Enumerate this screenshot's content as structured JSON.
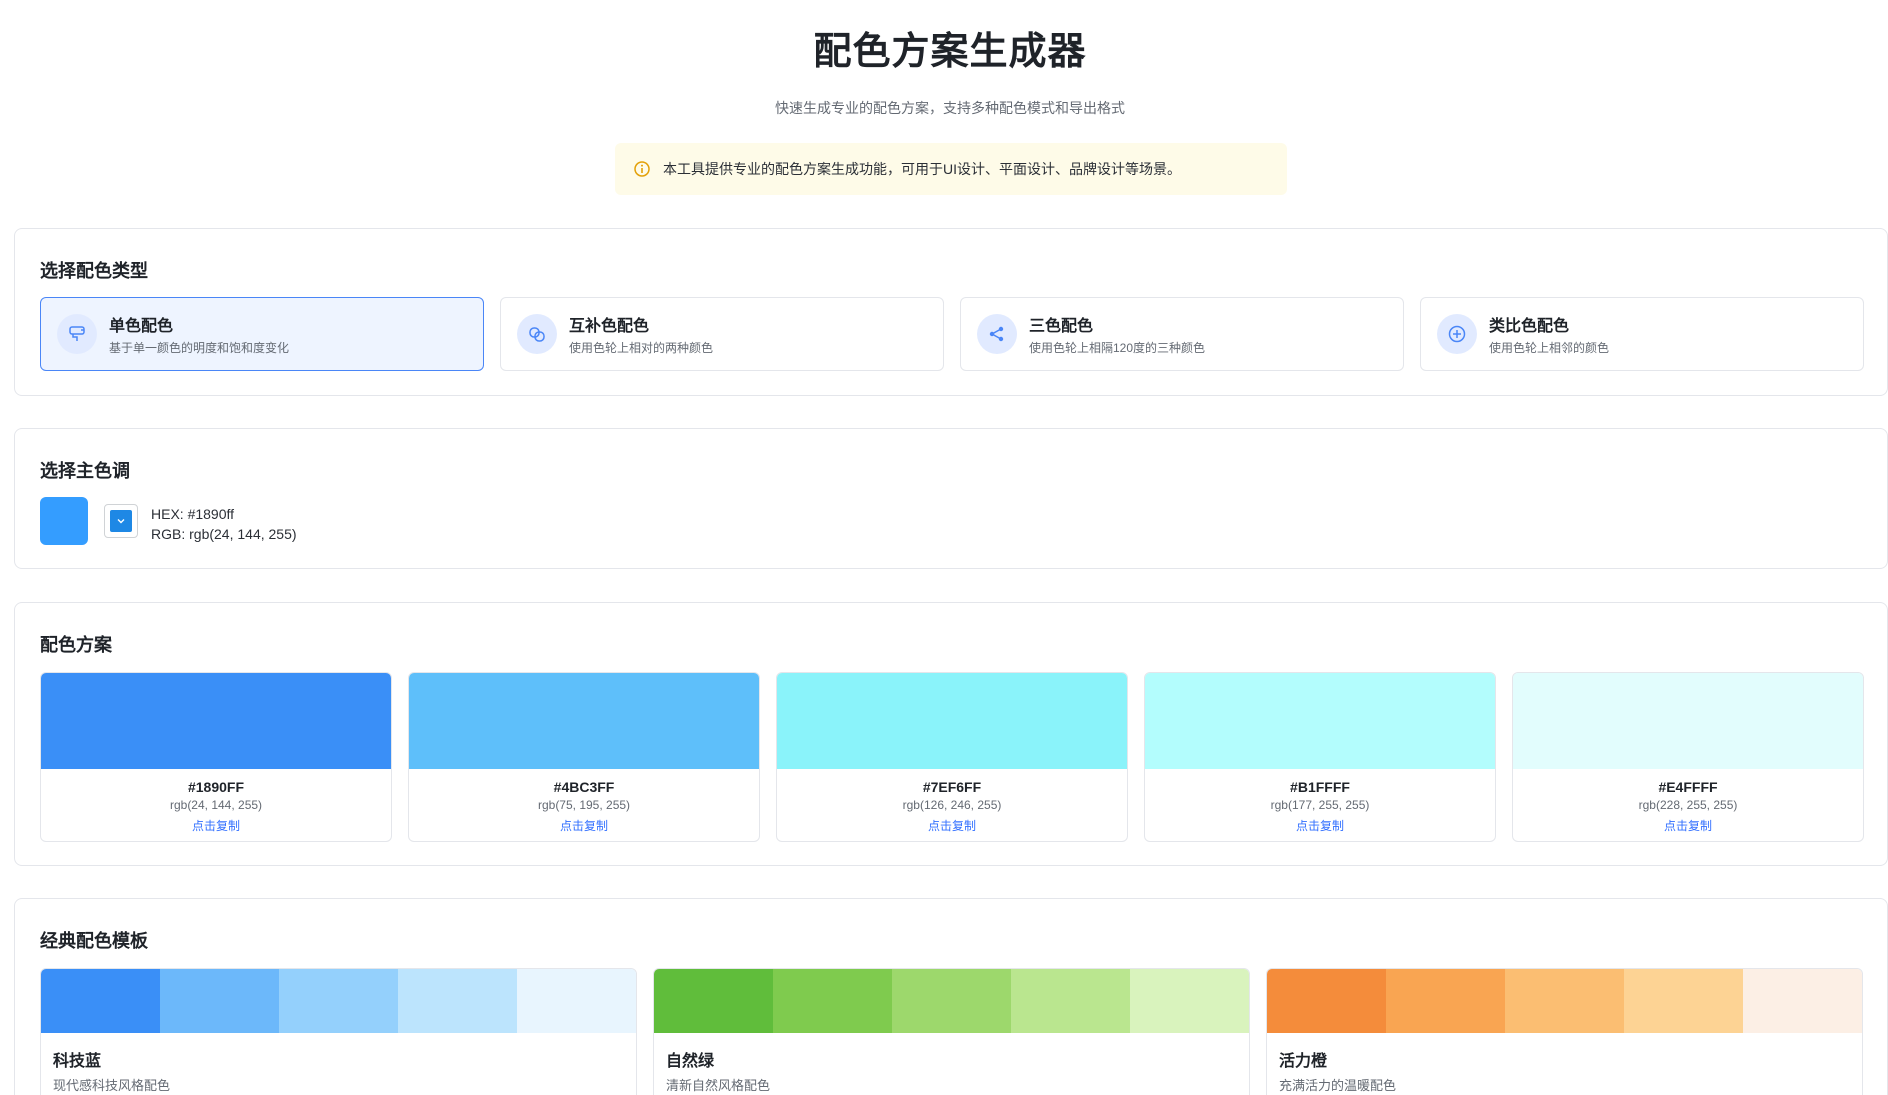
{
  "header": {
    "title": "配色方案生成器",
    "subtitle": "快速生成专业的配色方案，支持多种配色模式和导出格式",
    "notice": "本工具提供专业的配色方案生成功能，可用于UI设计、平面设计、品牌设计等场景。"
  },
  "type_section": {
    "title": "选择配色类型",
    "options": [
      {
        "label": "单色配色",
        "desc": "基于单一颜色的明度和饱和度变化",
        "icon": "palette-icon",
        "active": true
      },
      {
        "label": "互补色配色",
        "desc": "使用色轮上相对的两种颜色",
        "icon": "overlap-circles-icon",
        "active": false
      },
      {
        "label": "三色配色",
        "desc": "使用色轮上相隔120度的三种颜色",
        "icon": "share-icon",
        "active": false
      },
      {
        "label": "类比色配色",
        "desc": "使用色轮上相邻的颜色",
        "icon": "plus-circle-icon",
        "active": false
      }
    ]
  },
  "main_color": {
    "title": "选择主色调",
    "hex_text": "HEX: #1890ff",
    "rgb_text": "RGB: rgb(24, 144, 255)",
    "color": "#1890ff"
  },
  "scheme": {
    "title": "配色方案",
    "swatches": [
      {
        "hex": "#1890FF",
        "rgb": "rgb(24, 144, 255)",
        "copy": "点击复制",
        "color": "#3a8ff7"
      },
      {
        "hex": "#4BC3FF",
        "rgb": "rgb(75, 195, 255)",
        "copy": "点击复制",
        "color": "#5ebffa"
      },
      {
        "hex": "#7EF6FF",
        "rgb": "rgb(126, 246, 255)",
        "copy": "点击复制",
        "color": "#8af3fa"
      },
      {
        "hex": "#B1FFFF",
        "rgb": "rgb(177, 255, 255)",
        "copy": "点击复制",
        "color": "#b3fdfd"
      },
      {
        "hex": "#E4FFFF",
        "rgb": "rgb(228, 255, 255)",
        "copy": "点击复制",
        "color": "#e2fdfd"
      }
    ]
  },
  "templates": {
    "title": "经典配色模板",
    "items": [
      {
        "name": "科技蓝",
        "desc": "现代感科技风格配色",
        "colors": [
          "#3a8ff7",
          "#6cb8fa",
          "#94d0fc",
          "#bce4fd",
          "#e8f5fe"
        ]
      },
      {
        "name": "自然绿",
        "desc": "清新自然风格配色",
        "colors": [
          "#60bd3b",
          "#7fcb4e",
          "#9dd86c",
          "#bae68f",
          "#d9f3bd"
        ]
      },
      {
        "name": "活力橙",
        "desc": "充满活力的温暖配色",
        "colors": [
          "#f48c3b",
          "#f9a552",
          "#fbbe72",
          "#fdd394",
          "#fcefe5"
        ]
      }
    ]
  }
}
